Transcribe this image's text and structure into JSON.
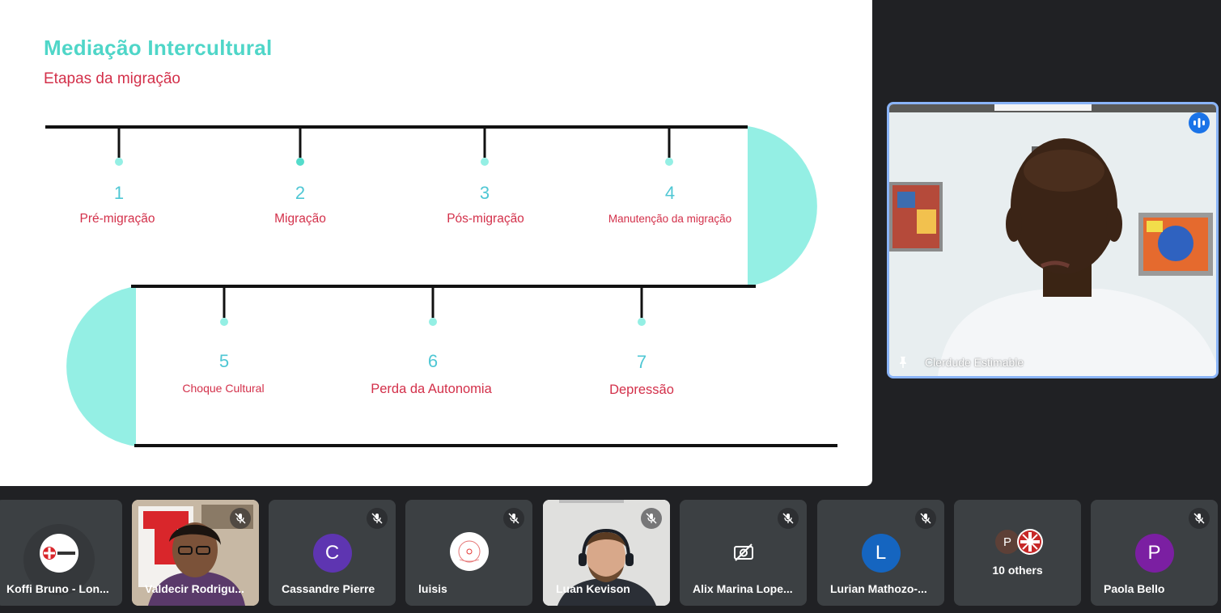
{
  "slide": {
    "title": "Mediação Intercultural",
    "subtitle": "Etapas da migração",
    "steps": [
      {
        "number": "1",
        "label": "Pré-migração"
      },
      {
        "number": "2",
        "label": "Migração"
      },
      {
        "number": "3",
        "label": "Pós-migração"
      },
      {
        "number": "4",
        "label": "Manutenção da migração"
      },
      {
        "number": "5",
        "label": "Choque Cultural"
      },
      {
        "number": "6",
        "label": "Perda da Autonomia"
      },
      {
        "number": "7",
        "label": "Depressão"
      }
    ]
  },
  "speaker": {
    "name": "Clerdude Estimable",
    "indicator_icon": "audio-level-icon",
    "pin_icon": "pin-icon"
  },
  "participants": [
    {
      "name": "Koffi Bruno - Lon...",
      "avatar": "caritas-logo"
    },
    {
      "name": "Valdecir Rodrigu...",
      "avatar": "video"
    },
    {
      "name": "Cassandre Pierre",
      "avatar": "C",
      "color": "#5e35b1"
    },
    {
      "name": "luisis",
      "avatar": "logo"
    },
    {
      "name": "Luan Kevison",
      "avatar": "video"
    },
    {
      "name": "Alix Marina Lope...",
      "avatar": "camera-off-icon"
    },
    {
      "name": "Lurian Mathozo-...",
      "avatar": "L",
      "color": "#1565c0"
    },
    {
      "name": "10 others",
      "avatar": "P"
    },
    {
      "name": "Paola Bello",
      "avatar": "P",
      "color": "#7b1fa2"
    }
  ],
  "colors": {
    "accent_teal": "#94efe4",
    "slide_title": "#4fd6c8",
    "slide_red": "#d3304a",
    "meet_background": "#202124",
    "tile_background": "#3c4043",
    "speaking_blue": "#8ab4f8"
  }
}
